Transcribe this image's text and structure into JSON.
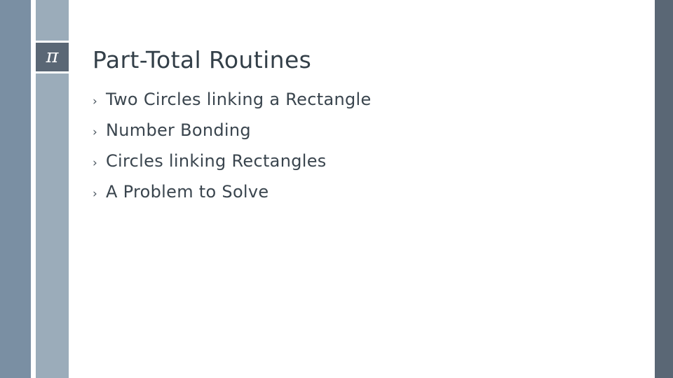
{
  "slide": {
    "logo": {
      "icon_name": "pi-symbol-icon",
      "glyph": "π"
    },
    "title": "Part-Total Routines",
    "bullet_marker": "›",
    "bullets": [
      {
        "text": "Two Circles linking a Rectangle"
      },
      {
        "text": "Number Bonding"
      },
      {
        "text": "Circles linking Rectangles"
      },
      {
        "text": "A Problem to Solve"
      }
    ]
  },
  "colors": {
    "bar_left_outer": "#7a8fa3",
    "bar_left_inner": "#9bacba",
    "bar_right": "#5a6775",
    "logo_tile": "#5a6775",
    "title_text": "#333f48",
    "bullet_text": "#3a454e",
    "background": "#ffffff"
  }
}
